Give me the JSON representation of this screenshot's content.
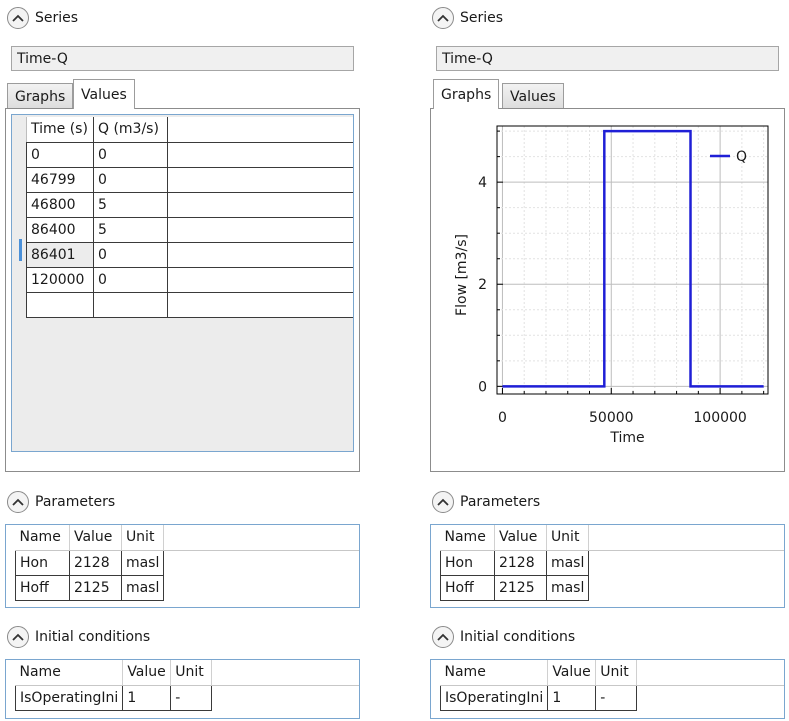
{
  "left": {
    "series_header": "Series",
    "title_value": "Time-Q",
    "tabs": [
      "Graphs",
      "Values"
    ],
    "active_tab": "Values",
    "values_table": {
      "headers": [
        "Time (s)",
        "Q (m3/s)"
      ],
      "rows": [
        [
          "0",
          "0"
        ],
        [
          "46799",
          "0"
        ],
        [
          "46800",
          "5"
        ],
        [
          "86400",
          "5"
        ],
        [
          "86401",
          "0"
        ],
        [
          "120000",
          "0"
        ],
        [
          "",
          ""
        ]
      ]
    },
    "parameters_header": "Parameters",
    "parameters": {
      "headers": [
        "Name",
        "Value",
        "Unit"
      ],
      "rows": [
        [
          "Hon",
          "2128",
          "masl"
        ],
        [
          "Hoff",
          "2125",
          "masl"
        ]
      ]
    },
    "initial_header": "Initial conditions",
    "initial": {
      "headers": [
        "Name",
        "Value",
        "Unit"
      ],
      "rows": [
        [
          "IsOperatingIni",
          "1",
          "-"
        ]
      ]
    }
  },
  "right": {
    "series_header": "Series",
    "title_value": "Time-Q",
    "tabs": [
      "Graphs",
      "Values"
    ],
    "active_tab": "Graphs",
    "parameters_header": "Parameters",
    "parameters": {
      "headers": [
        "Name",
        "Value",
        "Unit"
      ],
      "rows": [
        [
          "Hon",
          "2128",
          "masl"
        ],
        [
          "Hoff",
          "2125",
          "masl"
        ]
      ]
    },
    "initial_header": "Initial conditions",
    "initial": {
      "headers": [
        "Name",
        "Value",
        "Unit"
      ],
      "rows": [
        [
          "IsOperatingIni",
          "1",
          "-"
        ]
      ]
    }
  },
  "chart_data": {
    "type": "line",
    "title": "",
    "xlabel": "Time",
    "ylabel": "Flow [m3/s]",
    "xlim": [
      -2500,
      122000
    ],
    "ylim": [
      -0.15,
      5.1
    ],
    "xticks": [
      0,
      50000,
      100000
    ],
    "yticks": [
      0,
      2,
      4
    ],
    "grid": true,
    "legend_position": "top-right",
    "series": [
      {
        "name": "Q",
        "color": "#1f1fd6",
        "x": [
          0,
          46799,
          46800,
          86400,
          86401,
          120000
        ],
        "y": [
          0,
          0,
          5,
          5,
          0,
          0
        ]
      }
    ]
  }
}
